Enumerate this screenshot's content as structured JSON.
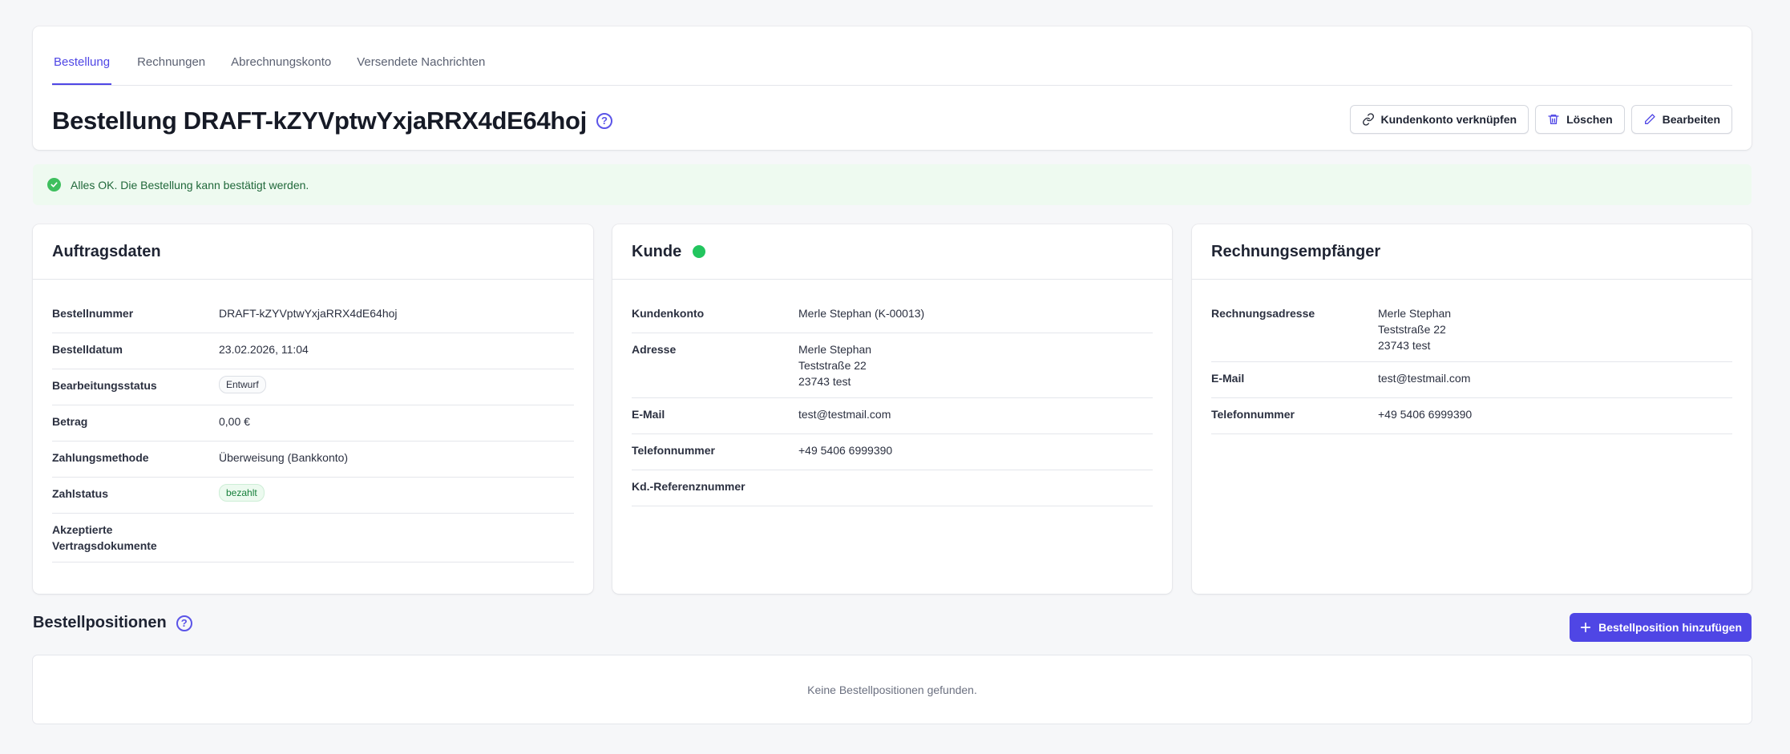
{
  "tabs": [
    {
      "label": "Bestellung",
      "active": true
    },
    {
      "label": "Rechnungen",
      "active": false
    },
    {
      "label": "Abrechnungskonto",
      "active": false
    },
    {
      "label": "Versendete Nachrichten",
      "active": false
    }
  ],
  "header": {
    "title": "Bestellung DRAFT-kZYVptwYxjaRRX4dE64hoj",
    "help_icon": "?",
    "actions": {
      "link_label": "Kundenkonto verknüpfen",
      "delete_label": "Löschen",
      "edit_label": "Bearbeiten"
    }
  },
  "alert": {
    "text": "Alles OK. Die Bestellung kann bestätigt werden."
  },
  "order": {
    "title": "Auftragsdaten",
    "rows": [
      {
        "label": "Bestellnummer",
        "value": "DRAFT-kZYVptwYxjaRRX4dE64hoj"
      },
      {
        "label": "Bestelldatum",
        "value": "23.02.2026, 11:04"
      },
      {
        "label": "Bearbeitungsstatus",
        "value": "Entwurf"
      },
      {
        "label": "Betrag",
        "value": "0,00 €"
      },
      {
        "label": "Zahlungsmethode",
        "value": "Überweisung (Bankkonto)"
      },
      {
        "label": "Zahlstatus",
        "value": "bezahlt"
      },
      {
        "label": "Akzeptierte Vertragsdokumente",
        "value": ""
      }
    ]
  },
  "customer": {
    "title": "Kunde",
    "status_color": "#22c55e",
    "rows": [
      {
        "label": "Kundenkonto",
        "value": "Merle Stephan (K-00013)"
      },
      {
        "label": "Adresse",
        "value_lines": [
          "Merle Stephan",
          "Teststraße 22",
          "23743 test"
        ]
      },
      {
        "label": "E-Mail",
        "value": "test@testmail.com"
      },
      {
        "label": "Telefonnummer",
        "value": "+49 5406 6999390"
      },
      {
        "label": "Kd.-Referenznummer",
        "value": ""
      }
    ]
  },
  "billing": {
    "title": "Rechnungsempfänger",
    "rows": [
      {
        "label": "Rechnungsadresse",
        "value_lines": [
          "Merle Stephan",
          "Teststraße 22",
          "23743 test"
        ]
      },
      {
        "label": "E-Mail",
        "value": "test@testmail.com"
      },
      {
        "label": "Telefonnummer",
        "value": "+49 5406 6999390"
      }
    ]
  },
  "positions": {
    "title": "Bestellpositionen",
    "add_label": "Bestellposition hinzufügen",
    "empty_text": "Keine Bestellpositionen gefunden."
  },
  "colors": {
    "accent": "#4f46e5",
    "success_bg": "#eefaf0",
    "success_text": "#20683a"
  }
}
